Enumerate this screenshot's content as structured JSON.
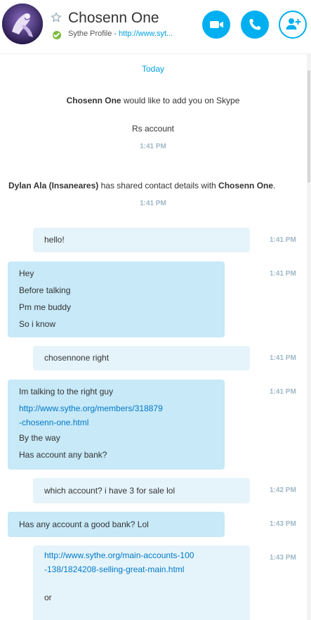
{
  "header": {
    "contact_name": "Chosenn One",
    "mood_prefix": "Sythe Profile - ",
    "mood_link": "http://www.syt..."
  },
  "chat": {
    "date_label": "Today",
    "system": [
      {
        "bold": "Chosenn One",
        "text": " would like to add you on Skype"
      },
      {
        "text": "Rs account"
      },
      {
        "time": "1:41 PM"
      },
      {
        "bold1": "Dylan Ala (Insaneares)",
        "mid": " has shared contact details with ",
        "bold2": "Chosenn One",
        "end": "."
      },
      {
        "time": "1:41 PM"
      }
    ],
    "messages": [
      {
        "dir": "out",
        "lines": [
          "hello!"
        ],
        "time": "1:41 PM"
      },
      {
        "dir": "in",
        "lines": [
          "Hey",
          "Before talking",
          "Pm me buddy",
          "So i know"
        ],
        "time": "1:41 PM"
      },
      {
        "dir": "out",
        "lines": [
          "chosennone right"
        ],
        "time": "1:41 PM"
      },
      {
        "dir": "in",
        "lines": [
          "Im talking to the right guy",
          "http://www.sythe.org/members/318879",
          "-chosenn-one.html",
          "By the way",
          "Has account any bank?"
        ],
        "time": "1:41 PM"
      },
      {
        "dir": "out",
        "lines": [
          "which account? i have 3 for sale lol"
        ],
        "time": "1:42 PM"
      },
      {
        "dir": "in",
        "lines": [
          "Has any account a good bank? Lol"
        ],
        "time": "1:43 PM"
      },
      {
        "dir": "out",
        "lines": [
          "http://www.sythe.org/main-accounts-100",
          "-138/1824208-selling-great-main.html",
          "",
          "or"
        ],
        "time": "1:43 PM"
      }
    ]
  },
  "colors": {
    "accent": "#00aff0",
    "outgoing_bubble": "#e5f4fb",
    "incoming_bubble": "#c7e9f8",
    "timestamp": "#9fb8c6",
    "link": "#0078c8",
    "online": "#7cbb3d"
  },
  "icons": [
    "favorite-star-icon",
    "online-status-icon",
    "video-call-icon",
    "audio-call-icon",
    "add-participant-icon"
  ]
}
